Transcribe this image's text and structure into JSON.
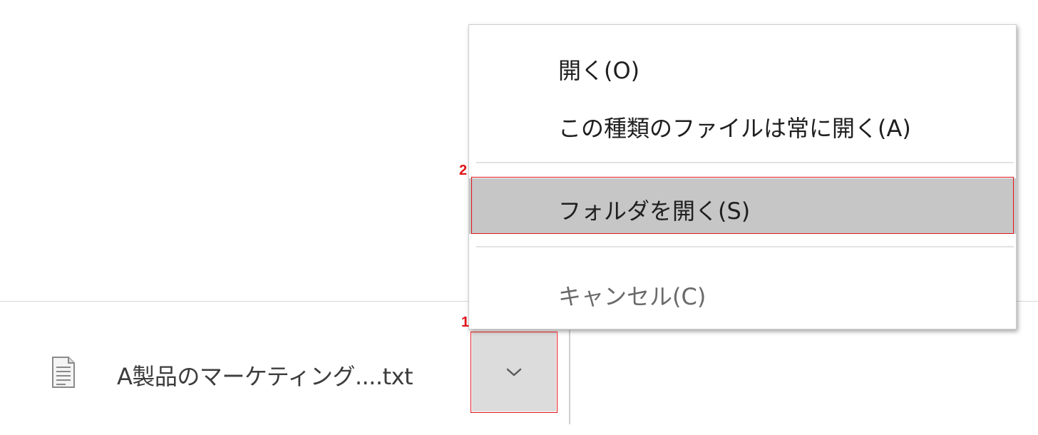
{
  "download_shelf": {
    "item": {
      "icon": "text-file-icon",
      "file_name": "A製品のマーケティング....txt",
      "dropdown_icon": "chevron-down-icon"
    }
  },
  "context_menu": {
    "items": [
      {
        "label": "開く(O)",
        "state": "normal"
      },
      {
        "label": "この種類のファイルは常に開く(A)",
        "state": "normal"
      },
      {
        "label": "フォルダを開く(S)",
        "state": "highlighted"
      },
      {
        "label": "キャンセル(C)",
        "state": "normal"
      }
    ]
  },
  "annotations": [
    {
      "number": "1",
      "target": "download-options-button"
    },
    {
      "number": "2",
      "target": "open-folder-menu-item"
    }
  ],
  "colors": {
    "annotation": "#e0141a",
    "highlight": "#c6c6c6",
    "dropdown_bg": "#dcdcdc"
  }
}
